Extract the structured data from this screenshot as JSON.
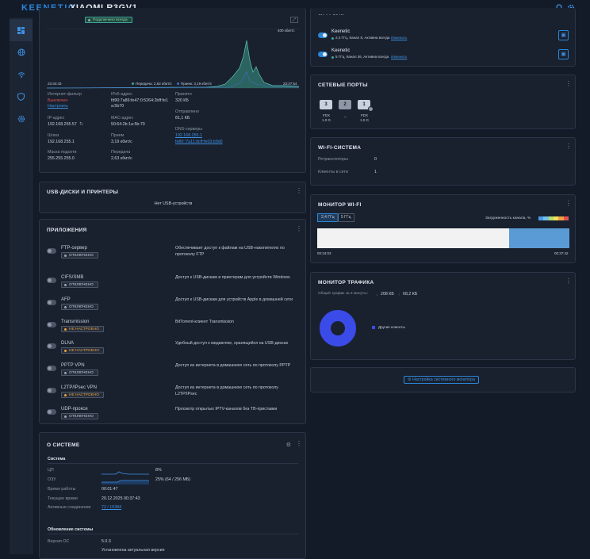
{
  "header": {
    "brand": "KEENETIC",
    "model": "XIAOMI R3GV1"
  },
  "dashboard": {
    "ipv6_status": "Подключено всегда",
    "graph_max": "400 кбит/с",
    "graph_start": "23:34:43",
    "graph_end": "23:37:54",
    "legend_tx": "Передача: 2,62 кбит/с",
    "legend_rx": "Прием: 3,19 кбит/с",
    "filter_label": "Интернет-фильтр",
    "filter_value": "Выключен",
    "filter_link": "Настроить",
    "ipv6_label": "IPv6-адрес",
    "ipv6_value1": "fd90:7a86:fe47:0:5264:2bff:fe1",
    "ipv6_value2": "a:5b70",
    "received_label": "Принято",
    "received_value": "320 КБ",
    "ip_label": "IP-адрес",
    "ip_value": "192.168.255.57",
    "mac_label": "MAC-адрес",
    "mac_value": "50:64:2b:1a:5b:70",
    "sent_label": "Отправлено",
    "sent_value": "81,1 КБ",
    "gateway_label": "Шлюз",
    "gateway_value": "192.168.255.1",
    "rx_label": "Прием",
    "rx_value": "3,19 кбит/с",
    "dns_label": "DNS-серверы",
    "dns1": "192.168.255.1",
    "dns2": "fe80::7a11:dcff:fe03:b9d0",
    "mask_label": "Маска подсети",
    "mask_value": "255.255.255.0",
    "tx_label": "Передача",
    "tx_value": "2,63 кбит/с"
  },
  "usb": {
    "title": "USB-ДИСКИ И ПРИНТЕРЫ",
    "empty": "Нет USB-устройств"
  },
  "apps": {
    "title": "ПРИЛОЖЕНИЯ",
    "items": [
      {
        "name": "FTP-сервер",
        "status": "ОТКЛЮЧЕНО",
        "desc": "Обеспечивает доступ к файлам на USB-накопителях по",
        "desc2": "протоколу FTP"
      },
      {
        "name": "CIFS/SMB",
        "status": "ОТКЛЮЧЕНО",
        "desc": "Доступ к USB-дискам и принтерам для устройств Windows",
        "desc2": ""
      },
      {
        "name": "AFP",
        "status": "ОТКЛЮЧЕНО",
        "desc": "Доступ к USB-дискам для устройств Apple в домашней сети",
        "desc2": ""
      },
      {
        "name": "Transmission",
        "status": "НЕ НАСТРОЕНО",
        "desc": "BitTorrent-клиент Transmission",
        "desc2": ""
      },
      {
        "name": "DLNA",
        "status": "НЕ НАСТРОЕНО",
        "desc": "Удобный доступ к медиатеке, хранящейся на USB-дисках",
        "desc2": ""
      },
      {
        "name": "PPTP VPN",
        "status": "ОТКЛЮЧЕНО",
        "desc": "Доступ из интернета в домашнюю сеть по протоколу PPTP",
        "desc2": ""
      },
      {
        "name": "L2TP/IPsec VPN",
        "status": "НЕ НАСТРОЕНО",
        "desc": "Доступ из интернета в домашнюю сеть по протоколу",
        "desc2": "L2TP/IPsec"
      },
      {
        "name": "UDP-прокси",
        "status": "ОТКЛЮЧЕНО",
        "desc": "Просмотр открытых IPTV-каналов без ТВ-приставки",
        "desc2": ""
      }
    ]
  },
  "system": {
    "title": "О СИСТЕМЕ",
    "section": "Система",
    "cpu_label": "ЦП",
    "cpu_value": "8%",
    "ram_label": "ОЗУ",
    "ram_value": "25% (64 / 256 МБ)",
    "uptime_label": "Время работы",
    "uptime_value": "00:01:47",
    "time_label": "Текущее время",
    "time_value": "20.12.2025 00:37:43",
    "conn_label": "Активные соединения",
    "conn_value": "72 / 16384",
    "update_section": "Обновление системы",
    "os_label": "Версия ОС",
    "os_value": "5.0.3",
    "os_status": "Установлена актуальная версия"
  },
  "wifi_nets": {
    "title_partial": "Wi-Fi-сети",
    "items": [
      {
        "name": "Keenetic",
        "info": "2,4 ГГц, Канал 8, Активна всегда",
        "link": "Изменить"
      },
      {
        "name": "Keenetic",
        "info": "5 ГГц, Канал 36, Активна всегда",
        "link": "Изменить"
      }
    ]
  },
  "ports": {
    "title": "СЕТЕВЫЕ ПОРТЫ",
    "items": [
      {
        "num": "3",
        "mode": "FDX",
        "speed": "1.0 G"
      },
      {
        "num": "2",
        "mode": "–",
        "speed": ""
      },
      {
        "num": "1",
        "mode": "FDX",
        "speed": "1.0 G"
      }
    ]
  },
  "wifisys": {
    "title": "WI-FI-СИСТЕМА",
    "repeaters_label": "Ретрансляторы",
    "repeaters_value": "0",
    "clients_label": "Клиенты в сети",
    "clients_value": "1"
  },
  "wifimon": {
    "title": "МОНИТОР WI-FI",
    "tab1": "2,4 ГГц",
    "tab2": "5 ГГц",
    "load_label": "Загруженность канала, %",
    "t_start": "00:34:03",
    "t_end": "00:37:42",
    "load_fraction_colored": 0.24
  },
  "traffic": {
    "title": "МОНИТОР ТРАФИКА",
    "total_label": "Общий трафик за 3 минуты:",
    "down": "208 КБ",
    "up": "68,2 КБ",
    "legend": "Другие клиенты",
    "color": "#3a4be8"
  },
  "monitor_button": "Настройка системного монитора",
  "colors": {
    "accent": "#2b86d6",
    "graph": "#3fa39a",
    "warn": "#e8a13d",
    "alert": "#e05151"
  }
}
